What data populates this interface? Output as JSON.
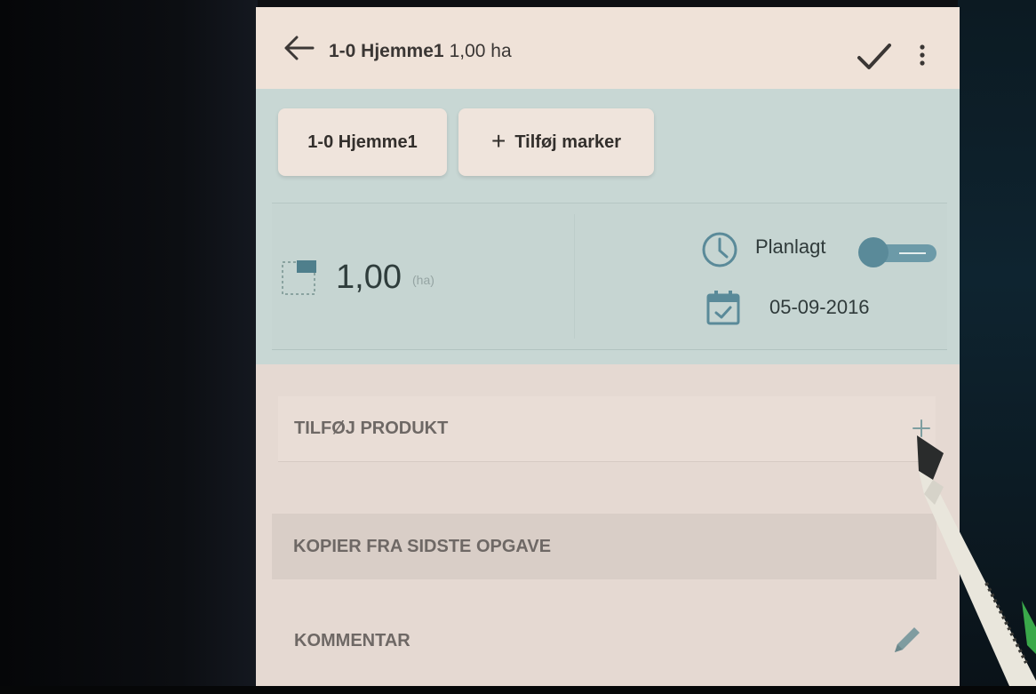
{
  "appbar": {
    "title_field": "1-0 Hjemme1",
    "title_area": "1,00 ha",
    "back_icon": "arrow-left-icon",
    "confirm_icon": "checkmark-icon",
    "menu_icon": "more-vertical-icon"
  },
  "chips": {
    "field_label": "1-0 Hjemme1",
    "add_label": "Tilføj marker",
    "add_symbol": "+"
  },
  "summary": {
    "area_value": "1,00",
    "area_unit": "(ha)",
    "planned_label": "Planlagt",
    "date": "05-09-2016",
    "planned_toggle": "on"
  },
  "list": {
    "add_product": "TILFØJ PRODUKT",
    "copy_last_task": "KOPIER FRA SIDSTE OPGAVE",
    "comment": "KOMMENTAR"
  },
  "colors": {
    "accent": "#5a8a99",
    "band": "#c8d7d4",
    "surface": "#e9dcd4"
  }
}
